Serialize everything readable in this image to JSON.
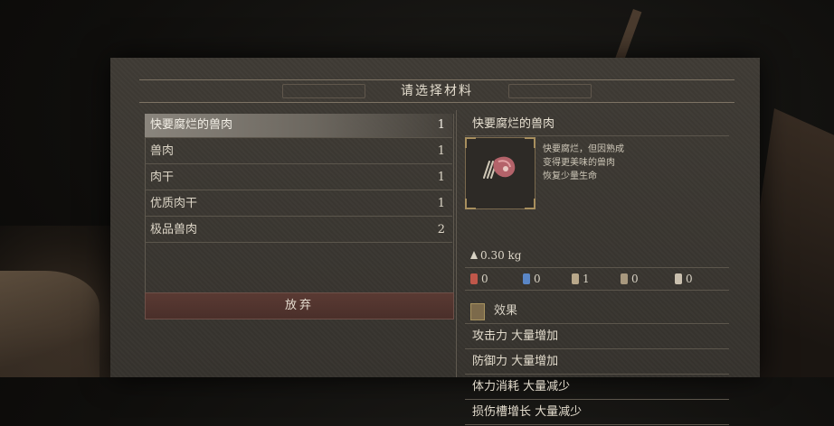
{
  "dialog": {
    "title": "请选择材料",
    "discard_label": "放弃"
  },
  "materials": [
    {
      "name": "快要腐烂的兽肉",
      "qty": "1",
      "selected": true
    },
    {
      "name": "兽肉",
      "qty": "1",
      "selected": false
    },
    {
      "name": "肉干",
      "qty": "1",
      "selected": false
    },
    {
      "name": "优质肉干",
      "qty": "1",
      "selected": false
    },
    {
      "name": "极品兽肉",
      "qty": "2",
      "selected": false
    }
  ],
  "detail": {
    "name": "快要腐烂的兽肉",
    "description": [
      "快要腐烂，但因熟成",
      "变得更美味的兽肉",
      "恢复少量生命"
    ],
    "weight": "0.30 kg",
    "stats": [
      {
        "icon": "slash-resist-icon",
        "value": "0",
        "color": "#c0574a"
      },
      {
        "icon": "magic-resist-icon",
        "value": "0",
        "color": "#5a86c6"
      },
      {
        "icon": "strike-resist-icon",
        "value": "1",
        "color": "#b9a88a"
      },
      {
        "icon": "bleed-resist-icon",
        "value": "0",
        "color": "#a8987e"
      },
      {
        "icon": "chest-icon",
        "value": "0",
        "color": "#c9bfae"
      }
    ],
    "effects_label": "效果",
    "effects": [
      "攻击力 大量增加",
      "防御力 大量增加",
      "体力消耗 大量减少",
      "损伤槽增长 大量减少"
    ]
  }
}
